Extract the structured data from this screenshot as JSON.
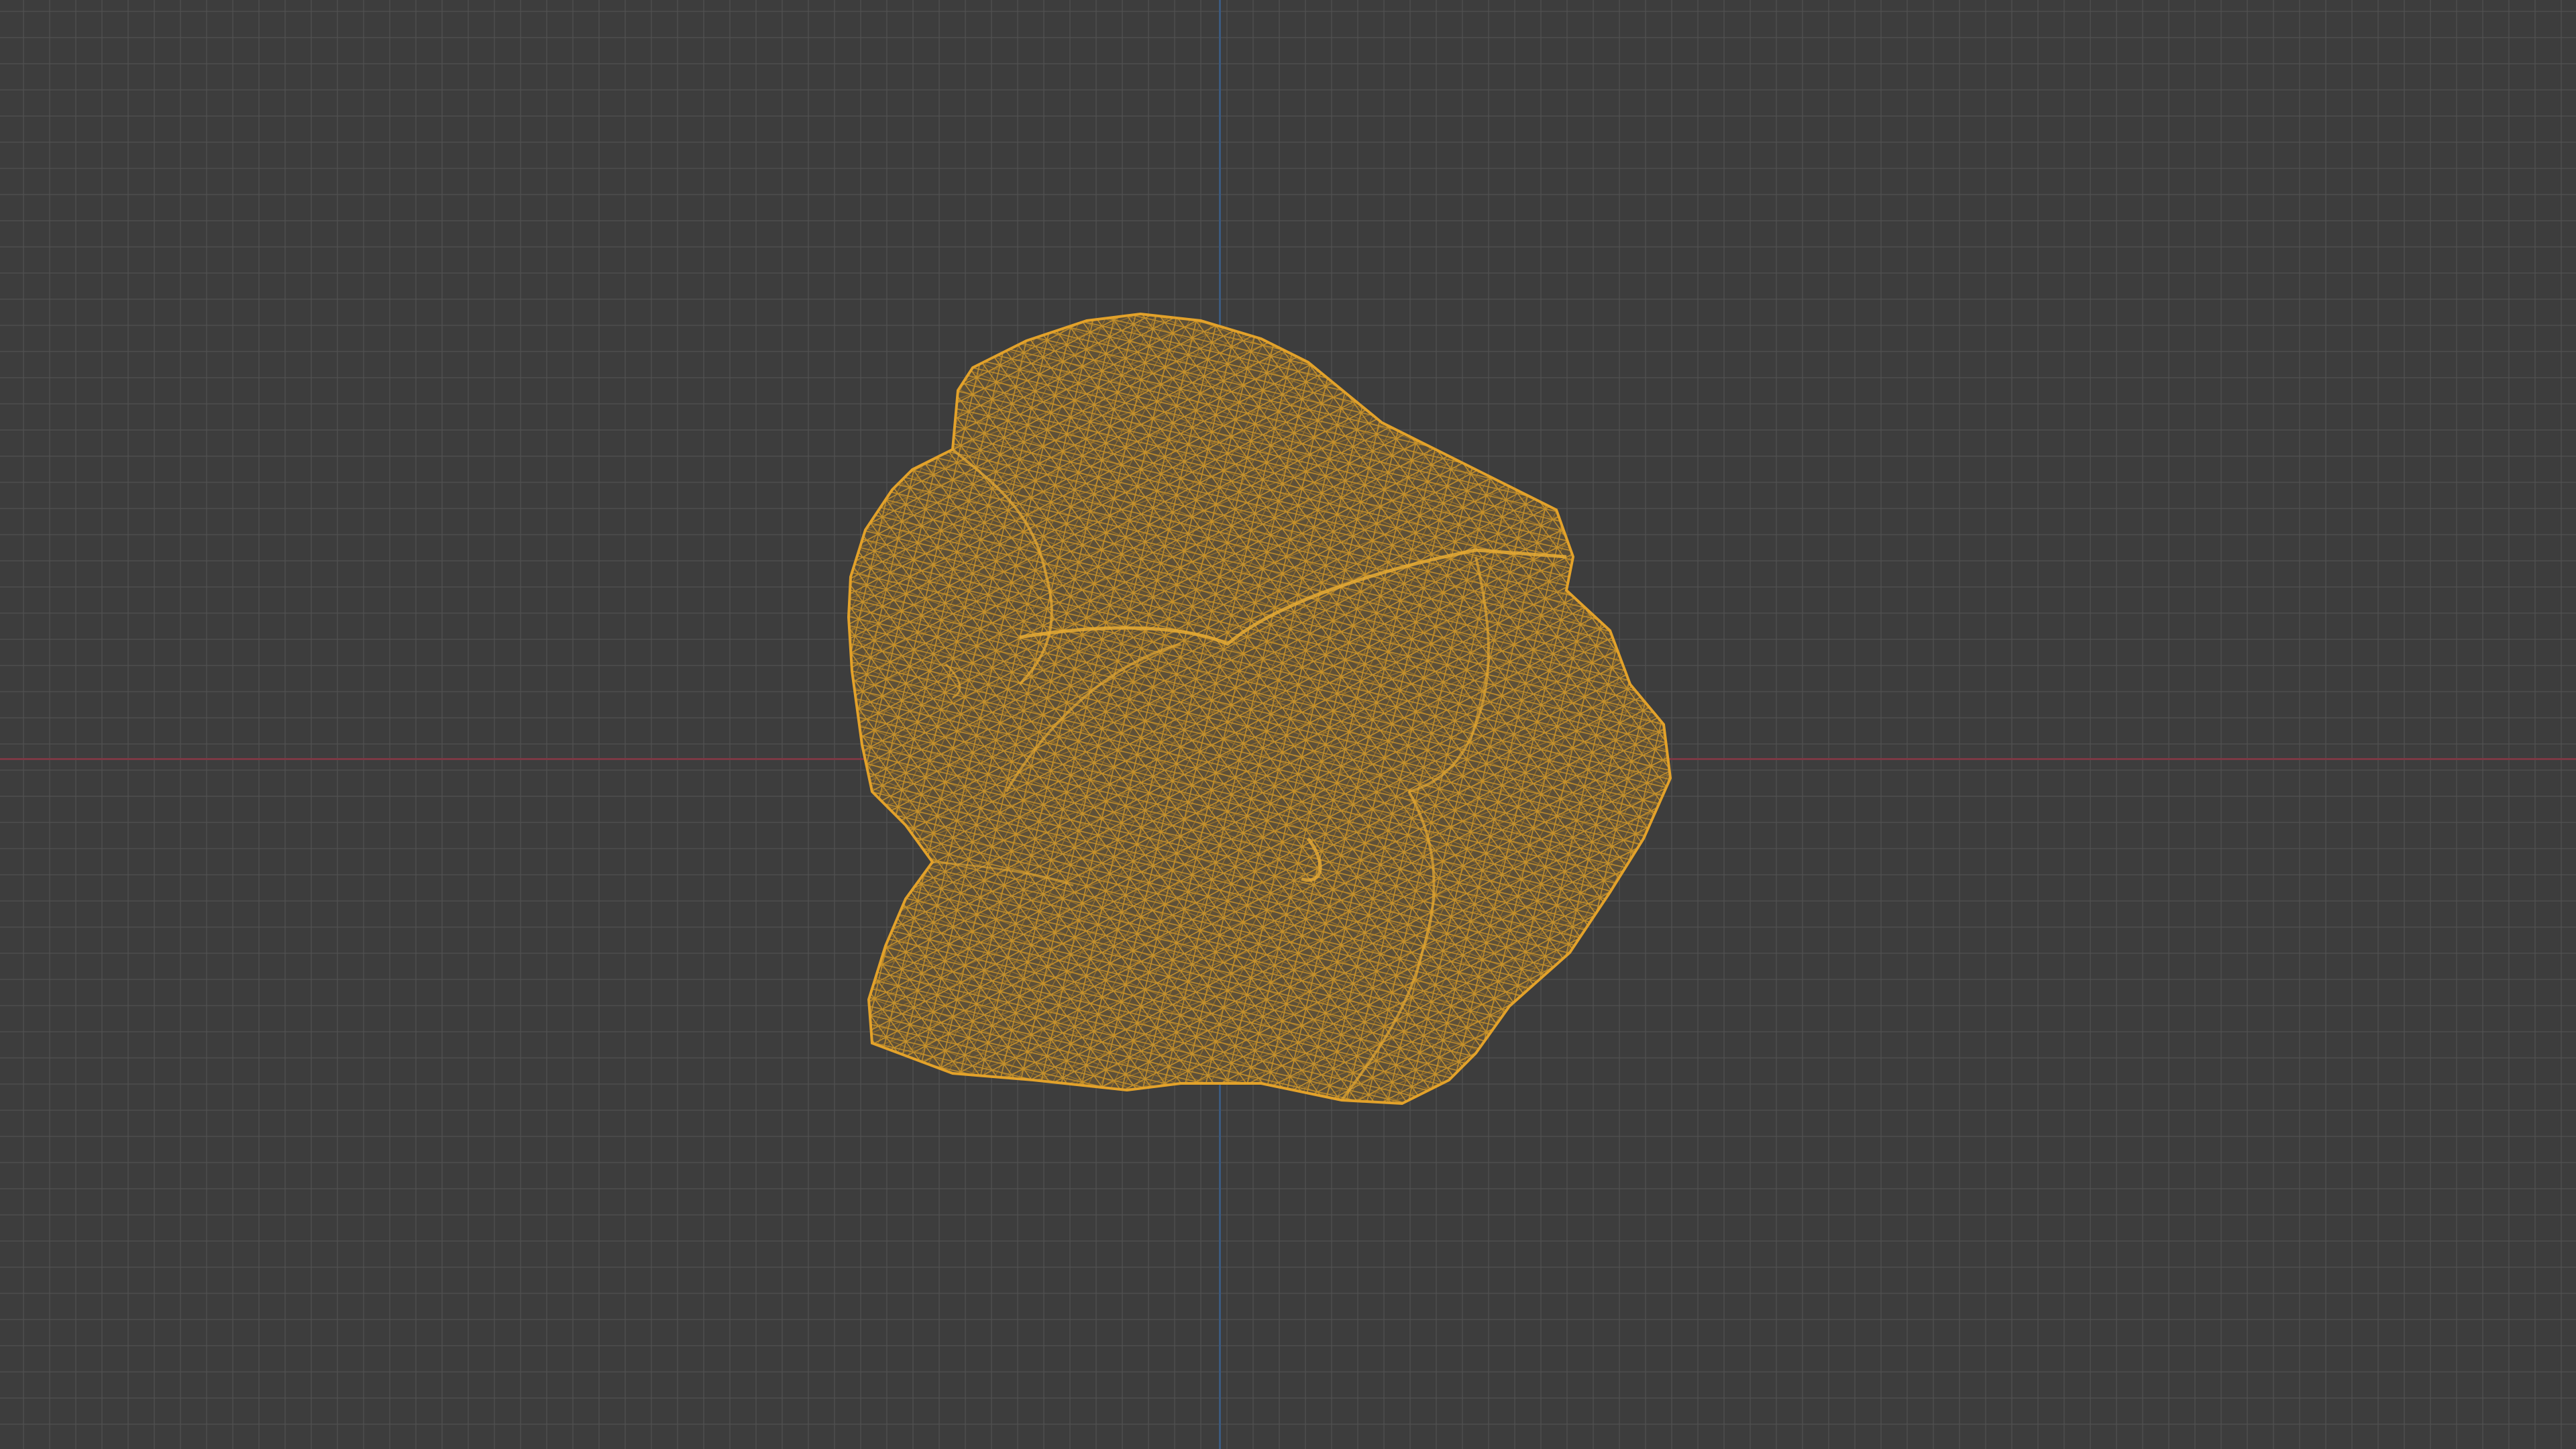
{
  "viewport": {
    "background_color": "#3d3d3d",
    "grid_color": "#525252",
    "x_axis_color": "#7b3944",
    "y_axis_color": "#3c5a7f",
    "display_mode": "wireframe"
  },
  "object": {
    "kind": "rock",
    "wire_color": "#d79c2a",
    "fill_color": "#5e5038",
    "selected": true
  }
}
